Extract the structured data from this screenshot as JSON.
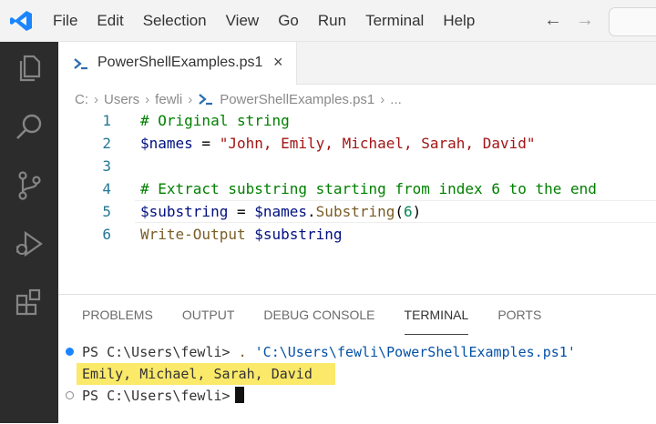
{
  "menu": {
    "items": [
      "File",
      "Edit",
      "Selection",
      "View",
      "Go",
      "Run",
      "Terminal",
      "Help"
    ],
    "nav_back": "←",
    "nav_forward": "→"
  },
  "tab": {
    "label": "PowerShellExamples.ps1",
    "close": "×"
  },
  "breadcrumb": {
    "items": [
      "C:",
      "Users",
      "fewli"
    ],
    "file": "PowerShellExamples.ps1",
    "tail": "..."
  },
  "editor": {
    "lines": [
      {
        "number": "1",
        "tokens": [
          {
            "t": "# Original string",
            "k": "comment"
          }
        ]
      },
      {
        "number": "2",
        "tokens": [
          {
            "t": "$names",
            "k": "var"
          },
          {
            "t": " = ",
            "k": "op"
          },
          {
            "t": "\"John, Emily, Michael, Sarah, David\"",
            "k": "str"
          }
        ]
      },
      {
        "number": "3",
        "tokens": []
      },
      {
        "number": "4",
        "tokens": [
          {
            "t": "# Extract substring starting from index 6 to the end",
            "k": "comment"
          }
        ]
      },
      {
        "number": "5",
        "tokens": [
          {
            "t": "$substring",
            "k": "var"
          },
          {
            "t": " = ",
            "k": "op"
          },
          {
            "t": "$names",
            "k": "var"
          },
          {
            "t": ".",
            "k": "op"
          },
          {
            "t": "Substring",
            "k": "method"
          },
          {
            "t": "(",
            "k": "op"
          },
          {
            "t": "6",
            "k": "num"
          },
          {
            "t": ")",
            "k": "op"
          }
        ]
      },
      {
        "number": "6",
        "tokens": [
          {
            "t": "Write-Output",
            "k": "cmd"
          },
          {
            "t": " ",
            "k": "op"
          },
          {
            "t": "$substring",
            "k": "var"
          }
        ]
      }
    ]
  },
  "panel": {
    "tabs": [
      "PROBLEMS",
      "OUTPUT",
      "DEBUG CONSOLE",
      "TERMINAL",
      "PORTS"
    ],
    "active_tab": "TERMINAL"
  },
  "terminal": {
    "prompt": "PS C:\\Users\\fewli> ",
    "command_dot": ".",
    "command_path": "'C:\\Users\\fewli\\PowerShellExamples.ps1'",
    "output": "Emily, Michael, Sarah, David",
    "prompt2": "PS C:\\Users\\fewli>"
  },
  "colors": {
    "activity_bar": "#2c2c2c",
    "vscode_blue": "#1a85ff",
    "highlight_yellow": "#fbe96a"
  },
  "icons": {
    "logo": "vscode-logo",
    "activity": [
      "explorer-icon",
      "search-icon",
      "source-control-icon",
      "run-debug-icon",
      "extensions-icon"
    ]
  }
}
